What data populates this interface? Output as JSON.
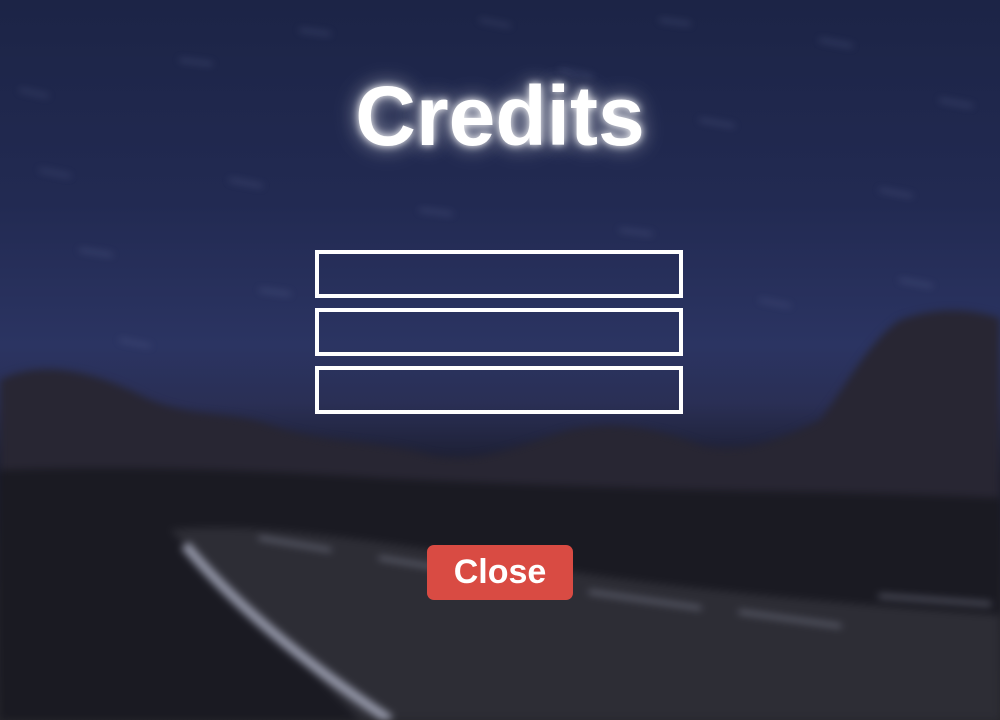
{
  "screen": {
    "title": "Credits"
  },
  "credits": {
    "entries": [
      "",
      "",
      ""
    ]
  },
  "buttons": {
    "close_label": "Close"
  },
  "colors": {
    "close_button": "#d94b43",
    "sky": "#222a52",
    "text": "#ffffff"
  }
}
